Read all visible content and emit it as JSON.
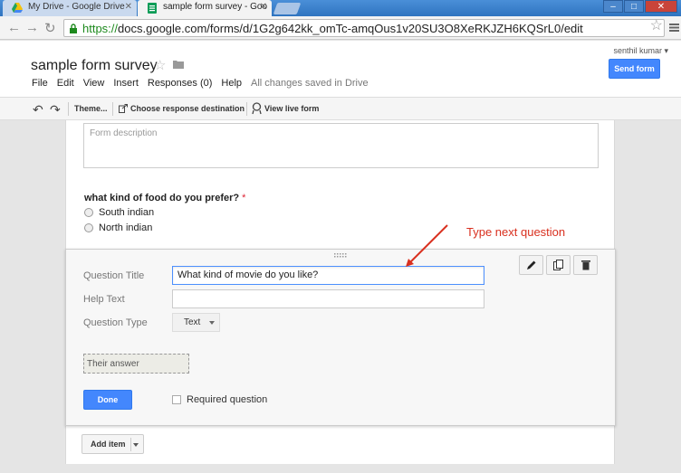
{
  "browser": {
    "tabs": [
      {
        "title": "My Drive - Google Drive",
        "active": false
      },
      {
        "title": "sample form survey - Goo",
        "active": true
      }
    ],
    "url_scheme": "https://",
    "url_rest": "docs.google.com/forms/d/1G2g642kk_omTc-amqOus1v20SU3O8XeRKJZH6KQSrL0/edit"
  },
  "header": {
    "account": "senthil kumar ▾",
    "send_label": "Send form",
    "doc_title": "sample form survey",
    "menu": [
      "File",
      "Edit",
      "View",
      "Insert",
      "Responses (0)",
      "Help"
    ],
    "save_status": "All changes saved in Drive"
  },
  "toolbar": {
    "theme_label": "Theme...",
    "response_label": "Choose response destination",
    "live_label": "View live form"
  },
  "form": {
    "description_placeholder": "Form description",
    "question": {
      "title": "what kind of food do you prefer?",
      "required_mark": "*",
      "options": [
        "South indian",
        "North indian"
      ]
    },
    "editor": {
      "title_label": "Question Title",
      "title_value": "What kind of movie do you like?",
      "help_label": "Help Text",
      "help_value": "",
      "type_label": "Question Type",
      "type_value": "Text",
      "answer_placeholder": "Their answer",
      "done_label": "Done",
      "required_label": "Required question"
    },
    "add_item_label": "Add item"
  },
  "annotation": {
    "text": "Type next question",
    "color": "#d9301f"
  },
  "colors": {
    "accent_blue": "#4387fd",
    "tab_bar": "#2f74c0"
  }
}
